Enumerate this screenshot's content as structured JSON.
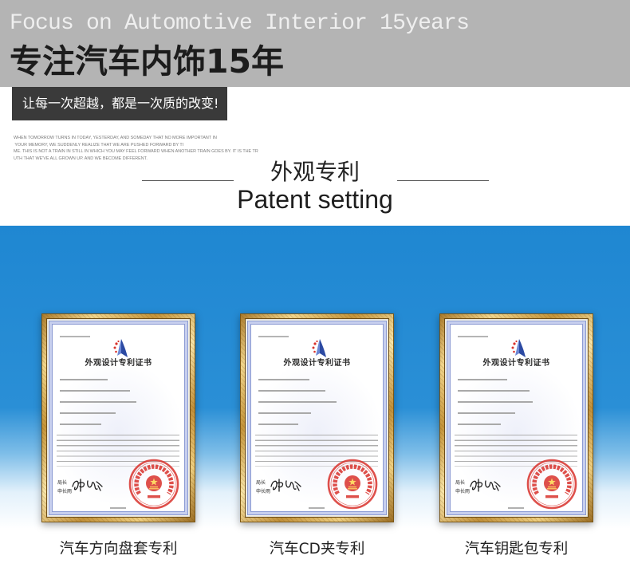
{
  "header": {
    "tagline_en": "Focus on Automotive Interior 15years",
    "tagline_cn": "专注汽车内饰15年",
    "slogan": "让每一次超越，都是一次质的改变!"
  },
  "intro_text": [
    "WHEN TOMORROW TURNS IN TODAY, YESTERDAY, AND SOMEDAY THAT NO MORE IMPORTANT IN",
    " YOUR MEMORY, WE SUDDENLY REALIZE THAT WE ARE PUSHED FORWARD BY TI",
    "ME. THIS IS NOT A TRAIN IN STILL IN WHICH YOU MAY FEEL FORWARD WHEN ANOTHER TRAIN GOES BY. IT IS THE TR",
    "UTH THAT WE'VE ALL GROWN UP. AND WE BECOME DIFFERENT."
  ],
  "section": {
    "title_cn": "外观专利",
    "title_en": "Patent setting"
  },
  "certificates": [
    {
      "caption": "汽车方向盘套专利",
      "title": "外观设计专利证书",
      "signer_title": "局长",
      "signer_name": "申长雨"
    },
    {
      "caption": "汽车CD夹专利",
      "title": "外观设计专利证书",
      "signer_title": "局长",
      "signer_name": "申长雨"
    },
    {
      "caption": "汽车钥匙包专利",
      "title": "外观设计专利证书",
      "signer_title": "局长",
      "signer_name": "申长雨"
    }
  ],
  "colors": {
    "header_band": "#b4b4b4",
    "slogan_box": "#3a3a3a",
    "blue_band": "#1f87d2",
    "frame_gold": "#c4943a",
    "seal_red": "#d9322c"
  }
}
